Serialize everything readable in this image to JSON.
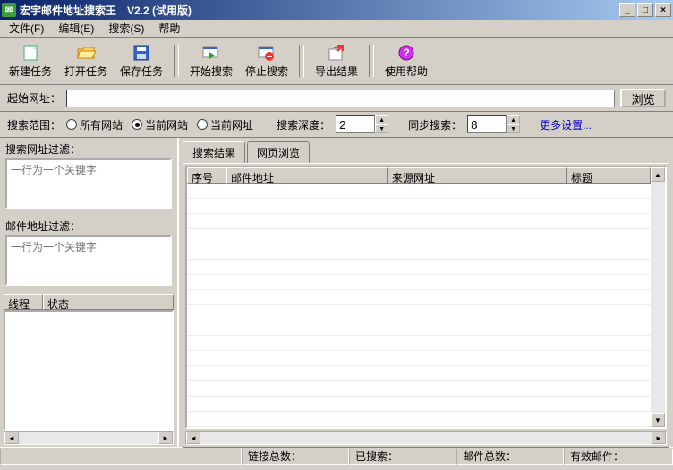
{
  "window": {
    "title": "宏宇邮件地址搜索王　V2.2 (试用版)",
    "min": "_",
    "max": "□",
    "close": "×"
  },
  "menu": {
    "file": "文件(F)",
    "edit": "编辑(E)",
    "search": "搜索(S)",
    "help": "帮助"
  },
  "toolbar": {
    "new_task": "新建任务",
    "open_task": "打开任务",
    "save_task": "保存任务",
    "start_search": "开始搜索",
    "stop_search": "停止搜索",
    "export": "导出结果",
    "help": "使用帮助"
  },
  "start_url": {
    "label": "起始网址：",
    "value": "",
    "browse": "浏览"
  },
  "options": {
    "scope_label": "搜索范围：",
    "scope_all": "所有网站",
    "scope_site": "当前网站",
    "scope_url": "当前网址",
    "depth_label": "搜索深度：",
    "depth_value": "2",
    "concurrent_label": "同步搜索：",
    "concurrent_value": "8",
    "more": "更多设置..."
  },
  "filters": {
    "url_filter_label": "搜索网址过滤：",
    "url_filter_placeholder": "一行为一个关键字",
    "email_filter_label": "邮件地址过滤：",
    "email_filter_placeholder": "一行为一个关键字"
  },
  "threads": {
    "col_thread": "线程",
    "col_status": "状态"
  },
  "tabs": {
    "results": "搜索结果",
    "webview": "网页浏览"
  },
  "results": {
    "col_seq": "序号",
    "col_email": "邮件地址",
    "col_source": "来源网址",
    "col_title": "标题"
  },
  "status": {
    "links_total": "链接总数：",
    "searched": "已搜索：",
    "emails_total": "邮件总数：",
    "valid_emails": "有效邮件："
  }
}
